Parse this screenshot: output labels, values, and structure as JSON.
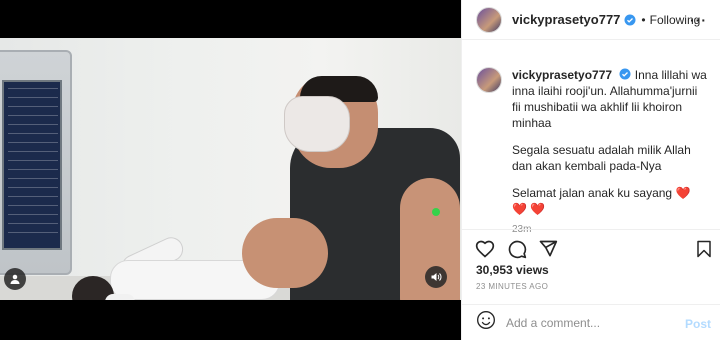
{
  "post": {
    "username": "vickyprasetyo777",
    "verified": true,
    "separator": "•",
    "follow_state": "Following",
    "more_icon": "more-horizontal-icon"
  },
  "caption": {
    "username": "vickyprasetyo777",
    "paragraphs": [
      "Inna lillahi wa inna ilaihi rooji'un. Allahumma'jurnii fii mushibatii wa akhlif lii khoiron minhaa",
      "Segala sesuatu adalah milik Allah dan akan kembali pada-Nya",
      "Selamat jalan anak ku sayang"
    ],
    "hearts": "❤️ ❤️ ❤️",
    "time": "23m"
  },
  "stats": {
    "views": "30,953 views",
    "posted": "23 MINUTES AGO"
  },
  "comment": {
    "placeholder": "Add a comment...",
    "post_label": "Post"
  },
  "colors": {
    "verified": "#3897f0",
    "heart": "#ed1c24",
    "post_disabled": "#b3dbff",
    "muted": "#8e8e8e"
  },
  "icons": [
    "heart-icon",
    "comment-icon",
    "share-icon",
    "bookmark-icon",
    "emoji-icon",
    "user-tag-icon",
    "sound-icon"
  ]
}
